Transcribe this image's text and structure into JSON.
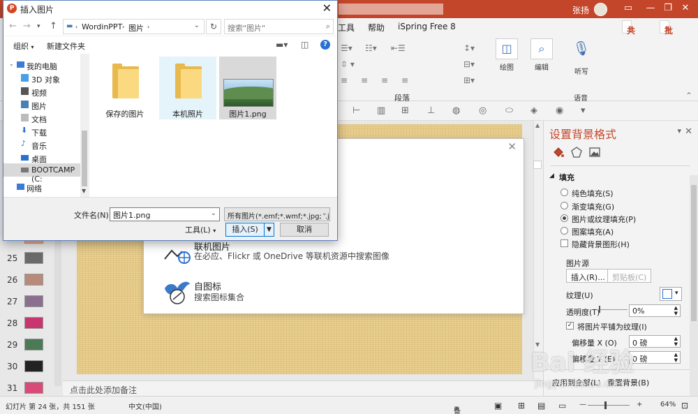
{
  "ppt": {
    "user_name": "张扬",
    "tabs": [
      "工具",
      "帮助",
      "iSpring Free 8"
    ],
    "share_label": "共享",
    "comment_label": "批注",
    "ribbon": {
      "paragraph_group": "段落",
      "draw_label": "绘图",
      "edit_label": "编辑",
      "listen_label": "听写",
      "voice_group": "语音"
    },
    "thumbnails": [
      {
        "num": "25",
        "color": "#6a6a6a"
      },
      {
        "num": "26",
        "color": "#b88a7a"
      },
      {
        "num": "27",
        "color": "#8a6f8f"
      },
      {
        "num": "28",
        "color": "#c8356f"
      },
      {
        "num": "29",
        "color": "#4c7a54"
      },
      {
        "num": "30",
        "color": "#222222"
      },
      {
        "num": "31",
        "color": "#d84b78"
      }
    ],
    "notes_placeholder": "点击此处添加备注",
    "insert_popup": {
      "online_title": "联机图片",
      "online_sub": "在必应、Flickr 或 OneDrive 等联机资源中搜索图像",
      "icons_title": "自图标",
      "icons_sub": "搜索图标集合"
    },
    "format_pane": {
      "title": "设置背景格式",
      "fill_section": "填充",
      "solid_fill": "纯色填充(S)",
      "gradient_fill": "渐变填充(G)",
      "picture_fill": "图片或纹理填充(P)",
      "pattern_fill": "图案填充(A)",
      "hide_bg": "隐藏背景图形(H)",
      "picture_source": "图片源",
      "insert_btn": "插入(R)...",
      "clipboard_btn": "剪贴板(C)",
      "texture_label": "纹理(U)",
      "transparency_label": "透明度(T)",
      "transparency_value": "0%",
      "tile_label": "将图片平铺为纹理(I)",
      "offset_x_label": "偏移量 X (O)",
      "offset_x_value": "0 磅",
      "offset_y_label": "偏移量 Y (E)",
      "offset_y_value": "0 磅",
      "apply_all": "应用到全部(L)",
      "reset_bg": "重置背景(B)"
    },
    "status": {
      "slide_info": "幻灯片 第 24 张，共 151 张",
      "language": "中文(中国)",
      "notes": "备注",
      "zoom": "64%"
    }
  },
  "dialog": {
    "title": "插入图片",
    "breadcrumb": [
      "WordinPPT",
      "图片"
    ],
    "search_placeholder": "搜索\"图片\"",
    "organize": "组织",
    "new_folder": "新建文件夹",
    "tree": [
      {
        "label": "我的电脑",
        "indent": 1,
        "color": "#3a7bd5"
      },
      {
        "label": "3D 对象",
        "indent": 2,
        "color": "#4aa0e6"
      },
      {
        "label": "视频",
        "indent": 2,
        "color": "#555"
      },
      {
        "label": "图片",
        "indent": 2,
        "color": "#4a7fb5"
      },
      {
        "label": "文档",
        "indent": 2,
        "color": "#888"
      },
      {
        "label": "下载",
        "indent": 2,
        "color": "#2a6fd1"
      },
      {
        "label": "音乐",
        "indent": 2,
        "color": "#2a6fd1"
      },
      {
        "label": "桌面",
        "indent": 2,
        "color": "#2a6fd1"
      },
      {
        "label": "BOOTCAMP (C:",
        "indent": 2,
        "color": "#777",
        "selected": true
      },
      {
        "label": "网络",
        "indent": 1,
        "color": "#3a7bd5"
      }
    ],
    "files": [
      {
        "name": "保存的图片",
        "kind": "folder"
      },
      {
        "name": "本机照片",
        "kind": "folder"
      },
      {
        "name": "图片1.png",
        "kind": "image"
      }
    ],
    "filename_label": "文件名(N):",
    "filename_value": "图片1.png",
    "filetype_value": "所有图片(*.emf;*.wmf;*.jpg;*.jp",
    "tools_label": "工具(L)",
    "insert_label": "插入(S)",
    "cancel_label": "取消"
  },
  "watermark": {
    "text": "Bai 经验",
    "sub": "jingyan.baidu.com"
  }
}
